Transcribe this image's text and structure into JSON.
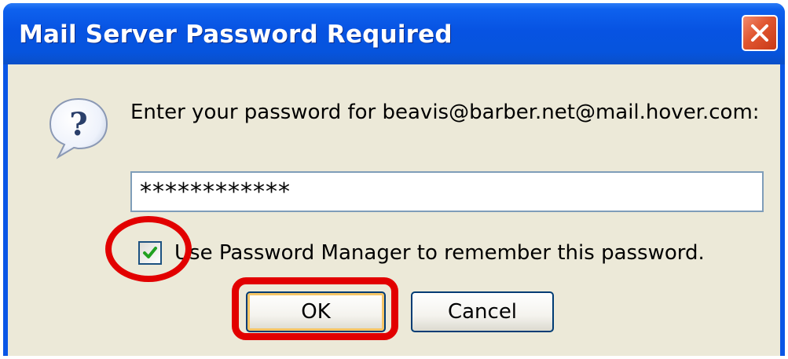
{
  "dialog": {
    "title": "Mail Server Password Required",
    "prompt": "Enter your password for beavis@barber.net@mail.hover.com:",
    "password_value": "************",
    "remember_label": "Use Password Manager to remember this password.",
    "remember_checked": true,
    "ok_label": "OK",
    "cancel_label": "Cancel"
  },
  "icons": {
    "close": "close-icon",
    "help": "question-bubble-icon",
    "check": "checkmark-icon"
  },
  "colors": {
    "titlebar": "#0654dd",
    "dialog_bg": "#ece9d8",
    "close_button": "#e0552f",
    "annotation": "#e20000",
    "check_mark": "#21a121"
  }
}
